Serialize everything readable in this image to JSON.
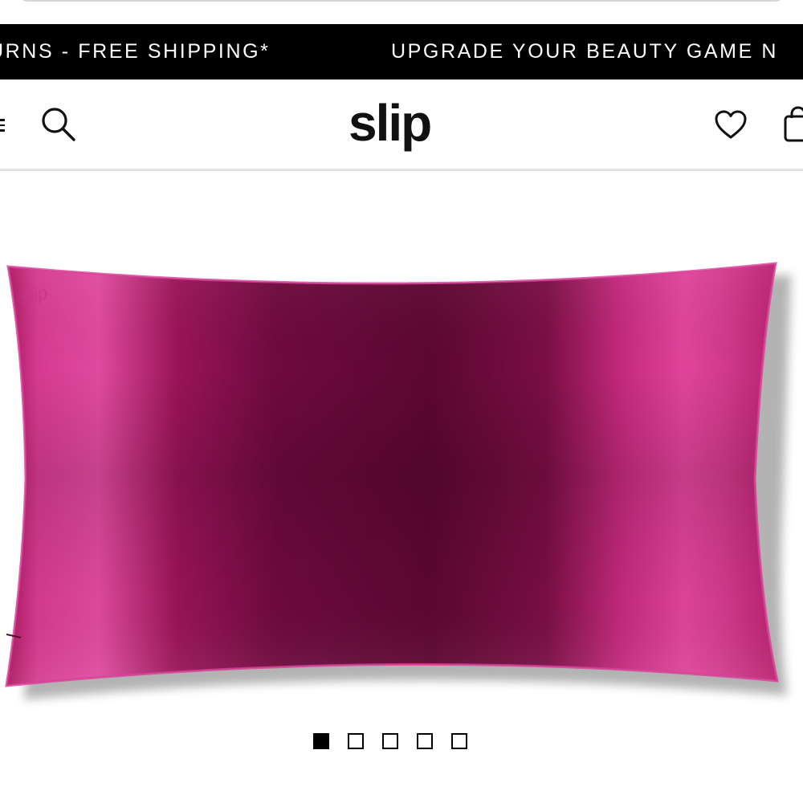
{
  "announcement": {
    "segment_1": "URNS - FREE SHIPPING*",
    "segment_2": "UPGRADE YOUR BEAUTY GAME N"
  },
  "header": {
    "logo_text": "slip",
    "icons": [
      "menu-icon",
      "search-icon",
      "heart-icon",
      "bag-icon"
    ]
  },
  "product": {
    "embossed_mark": "slip",
    "colors": {
      "silk_light": "#e2489e",
      "silk_mid": "#b8216f",
      "silk_dark": "#5e0832"
    }
  },
  "gallery": {
    "slide_count": 5,
    "active_slide": 1
  },
  "theme": {
    "announcement_bg": "#000000",
    "announcement_text": "#ffffff",
    "header_divider": "#e3e3e3"
  }
}
